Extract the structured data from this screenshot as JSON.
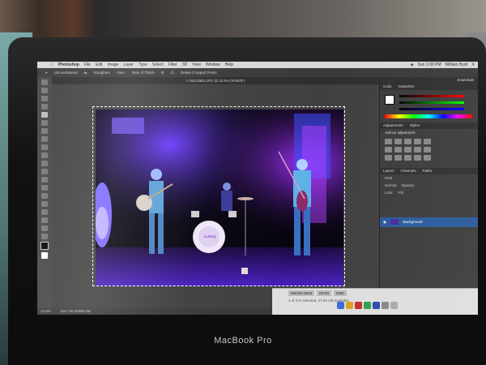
{
  "brand": "MacBook Pro",
  "menubar": {
    "app": "Photoshop",
    "items": [
      "File",
      "Edit",
      "Image",
      "Layer",
      "Type",
      "Select",
      "Filter",
      "3D",
      "View",
      "Window",
      "Help"
    ],
    "clock": "Sun 1:00 PM",
    "user": "William Byrd"
  },
  "options_bar": {
    "ratio": "Unconstrained",
    "straighten": "Straighten",
    "view": "View:",
    "overlay": "Rule of Thirds",
    "delete_cropped": "Delete Cropped Pixels"
  },
  "document": {
    "tab_title": "DSC4983.JPG @ 12.5% (RGB/8*)",
    "zoom": "12.5%",
    "doc_size": "Doc: 65.1M/65.1M"
  },
  "panels": {
    "essentials": "Essentials",
    "color_tab": "Color",
    "swatches_tab": "Swatches",
    "adjustments_tab": "Adjustments",
    "styles_tab": "Styles",
    "add_adjustment": "Add an adjustment",
    "layers_tab": "Layers",
    "channels_tab": "Channels",
    "paths_tab": "Paths",
    "kind": "Kind",
    "blend_mode": "Normal",
    "opacity_label": "Opacity:",
    "lock_label": "Lock:",
    "fill_label": "Fill:",
    "layer_name": "Background"
  },
  "finder": {
    "crumbs": [
      "NIKON D610",
      "DCIM",
      "3390"
    ],
    "status": "1 of 374 selected, 27.94 GB available"
  },
  "colors": {
    "stage_purple": "#5a1fd0",
    "stage_blue": "#2a3aff",
    "selection_blue": "#2a5a9a"
  }
}
